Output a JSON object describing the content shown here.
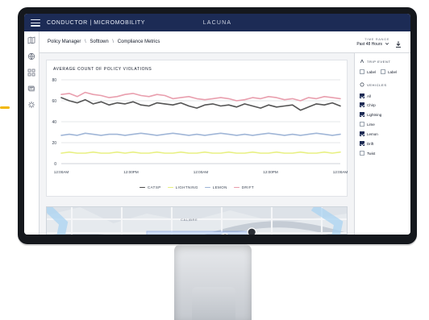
{
  "app": {
    "brand": "CONDUCTOR | MICROMOBILITY",
    "center_title": "LACUNA"
  },
  "nav": {
    "items": [
      {
        "name": "map-icon"
      },
      {
        "name": "globe-icon"
      },
      {
        "name": "grid-icon"
      },
      {
        "name": "cards-icon"
      },
      {
        "name": "settings-icon"
      }
    ]
  },
  "toolbar": {
    "breadcrumbs": [
      "Policy Manager",
      "Softtown",
      "Compliance Metrics"
    ],
    "time_range_label": "TIME RANGE",
    "time_range_value": "Past 48 Hours",
    "download_icon": "download-icon"
  },
  "chart_data": {
    "type": "line",
    "title": "AVERAGE COUNT OF POLICY VIOLATIONS",
    "xlabel": "",
    "ylabel": "",
    "x_ticks": [
      "12:00AM",
      "12:00PM",
      "12:00AM",
      "12:00PM",
      "12:00AM"
    ],
    "y_ticks": [
      0,
      20,
      40,
      60,
      80
    ],
    "ylim": [
      0,
      80
    ],
    "grid": true,
    "legend_placement": "bottom",
    "series": [
      {
        "name": "CATSP",
        "color": "#4b4b4b",
        "values": [
          63,
          60,
          58,
          61,
          57,
          59,
          56,
          58,
          57,
          59,
          56,
          55,
          58,
          57,
          56,
          58,
          55,
          53,
          56,
          57,
          55,
          56,
          54,
          57,
          55,
          53,
          56,
          54,
          55,
          56,
          51,
          54,
          57,
          56,
          58,
          55
        ]
      },
      {
        "name": "LIGHTNING",
        "color": "#e7ef7c",
        "values": [
          10,
          11,
          10,
          10,
          11,
          10,
          10,
          11,
          10,
          11,
          10,
          10,
          11,
          10,
          10,
          11,
          10,
          10,
          11,
          10,
          10,
          11,
          10,
          10,
          11,
          10,
          10,
          11,
          10,
          10,
          11,
          10,
          10,
          11,
          10,
          11
        ]
      },
      {
        "name": "LEMON",
        "color": "#9bb2d5",
        "values": [
          27,
          28,
          27,
          29,
          28,
          27,
          28,
          28,
          27,
          28,
          29,
          28,
          27,
          28,
          29,
          28,
          27,
          28,
          27,
          28,
          29,
          28,
          27,
          28,
          27,
          28,
          29,
          28,
          27,
          28,
          27,
          28,
          29,
          28,
          27,
          28
        ]
      },
      {
        "name": "DRIFT",
        "color": "#e89aaa",
        "values": [
          66,
          67,
          64,
          68,
          66,
          65,
          63,
          64,
          66,
          67,
          65,
          64,
          66,
          65,
          62,
          63,
          64,
          62,
          61,
          62,
          63,
          62,
          60,
          61,
          63,
          62,
          64,
          63,
          61,
          62,
          60,
          63,
          62,
          64,
          63,
          62
        ]
      }
    ]
  },
  "legend": {
    "items": [
      {
        "label": "CATSP",
        "color": "#4b4b4b"
      },
      {
        "label": "LIGHTNING",
        "color": "#e7ef7c"
      },
      {
        "label": "LEMON",
        "color": "#9bb2d5"
      },
      {
        "label": "DRIFT",
        "color": "#e89aaa"
      }
    ]
  },
  "right_panel": {
    "trip_event": {
      "title": "TRIP EVENT",
      "options": [
        {
          "label": "Label",
          "checked": false
        },
        {
          "label": "Label",
          "checked": false
        }
      ]
    },
    "vehicles": {
      "title": "VEHICLES",
      "all_label": "All",
      "all_checked": true,
      "items": [
        {
          "label": "Chirp",
          "checked": true
        },
        {
          "label": "Lightning",
          "checked": true
        },
        {
          "label": "Lime",
          "checked": false
        },
        {
          "label": "Lemon",
          "checked": true
        },
        {
          "label": "Drift",
          "checked": true
        },
        {
          "label": "Twist",
          "checked": false
        }
      ]
    }
  },
  "map": {
    "label": "CALIBRE"
  }
}
